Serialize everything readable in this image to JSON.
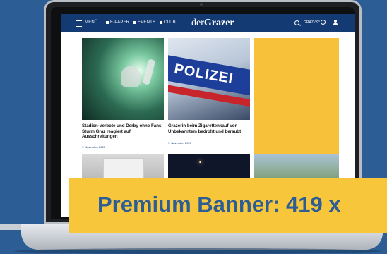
{
  "nav": {
    "menu_label": "MENÜ",
    "items": [
      "E-PAPER",
      "EVENTS",
      "CLUB"
    ],
    "brand_prefix": "der",
    "brand_name": "Grazer",
    "weather": "GRAZ / 9°"
  },
  "articles": [
    {
      "headline": "Stadion-Verbote und Derby ohne Fans: Sturm Graz reagiert auf Ausschreitungen",
      "date": "7. November 2023"
    },
    {
      "headline": "Grazerin beim Zigarettenkauf von Unbekanntem bedroht und beraubt",
      "date": "7. November 2023"
    }
  ],
  "images": {
    "police_text": "POLIZEI"
  },
  "banner": {
    "label": "Premium Banner: 419 x"
  },
  "colors": {
    "background": "#2c5d95",
    "nav": "#133a73",
    "ad_yellow": "#f7c23a",
    "banner_text": "#2c5d95"
  }
}
